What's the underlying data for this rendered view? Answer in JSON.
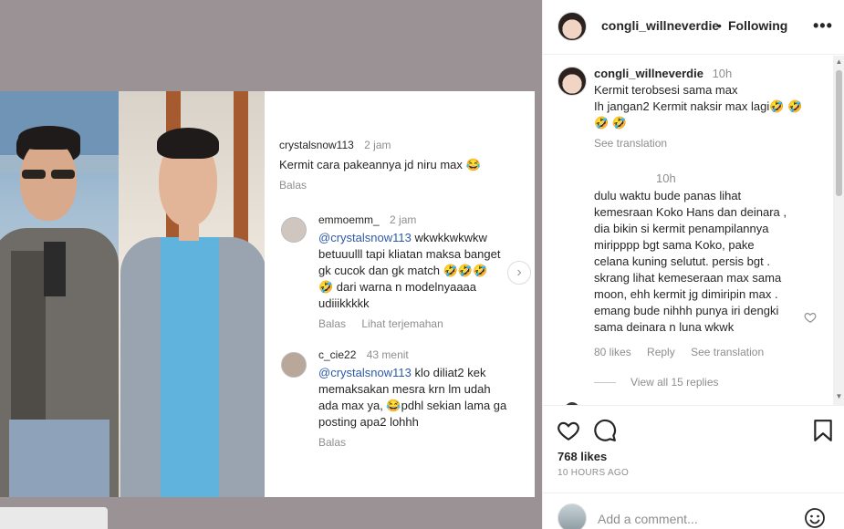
{
  "screenshot_comments": [
    {
      "user": "crystalsnow113",
      "time": "2 jam",
      "text": "Kermit cara pakeannya jd niru max 😂",
      "reply": "Balas"
    },
    {
      "user": "emmoemm_",
      "time": "2 jam",
      "mention": "@crystalsnow113",
      "text_lines": [
        " wkwkkwkwkw",
        "betuuulll tapi kliatan maksa banget",
        "gk cucok dan gk match 🤣🤣🤣",
        "🤣 dari warna n modelnyaaaa",
        "udiiikkkkk"
      ],
      "reply": "Balas",
      "translate": "Lihat terjemahan"
    },
    {
      "user": "c_cie22",
      "time": "43 menit",
      "mention": "@crystalsnow113",
      "text_lines": [
        " klo diliat2 kek",
        "memaksakan mesra krn lm udah",
        "ada max ya, 😂pdhl sekian lama ga",
        "posting apa2 lohhh"
      ],
      "reply": "Balas"
    }
  ],
  "header": {
    "username": "congli_willneverdie",
    "separator": "•",
    "follow_status": "Following",
    "more_icon": "more-horizontal-icon"
  },
  "caption": {
    "username": "congli_willneverdie",
    "time": "10h",
    "lines": [
      "Kermit terobsesi sama max",
      "Ih jangan2 Kermit naksir max lagi🤣 🤣",
      "🤣 🤣"
    ],
    "translate": "See translation"
  },
  "comment": {
    "time": "10h",
    "lines": [
      "dulu waktu bude panas lihat",
      "kemesraan Koko Hans dan deinara ,",
      "dia bikin si kermit penampilannya",
      "miripppp bgt sama Koko, pake",
      "celana kuning selutut. persis bgt .",
      "skrang lihat kemeseraan max sama",
      "moon, ehh kermit jg dimiripin max .",
      "emang bude nihhh punya iri dengki",
      "sama deinara n luna wkwk"
    ],
    "likes": "80 likes",
    "reply": "Reply",
    "translate": "See translation",
    "view_replies": "View all 15 replies"
  },
  "scrollbar": {
    "up": "▲",
    "down": "▼"
  },
  "actions": {
    "like_icon": "heart-icon",
    "comment_icon": "comment-bubble-icon",
    "save_icon": "bookmark-icon",
    "likes": "768 likes",
    "time_ago": "10 HOURS AGO"
  },
  "add_comment": {
    "placeholder": "Add a comment...",
    "emoji_icon": "emoji-smile-icon"
  },
  "colors": {
    "media_background": "#9a9294",
    "mention": "#2e5aa8",
    "muted_text": "#8e8e8e"
  }
}
